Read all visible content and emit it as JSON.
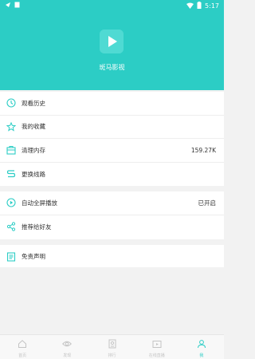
{
  "status_bar": {
    "time": "5:17"
  },
  "app": {
    "name": "斑马影视"
  },
  "menu_group_1": [
    {
      "label": "观看历史",
      "value": "",
      "icon": "history-clock-icon"
    },
    {
      "label": "我的收藏",
      "value": "",
      "icon": "favorite-star-icon"
    },
    {
      "label": "清理内存",
      "value": "159.27K",
      "icon": "clear-cache-icon"
    },
    {
      "label": "更换线路",
      "value": "",
      "icon": "switch-route-icon"
    }
  ],
  "menu_group_2": [
    {
      "label": "自动全屏播放",
      "value": "已开启",
      "icon": "play-circle-icon"
    },
    {
      "label": "推荐给好友",
      "value": "",
      "icon": "share-icon"
    }
  ],
  "menu_group_3": [
    {
      "label": "免责声明",
      "value": "",
      "icon": "disclaimer-book-icon"
    }
  ],
  "tabbar": [
    {
      "label": "首页",
      "icon": "home-icon",
      "active": false
    },
    {
      "label": "发现",
      "icon": "discover-eye-icon",
      "active": false
    },
    {
      "label": "排行",
      "icon": "rank-icon",
      "active": false
    },
    {
      "label": "在线直播",
      "icon": "live-tv-icon",
      "active": false
    },
    {
      "label": "我",
      "icon": "profile-icon",
      "active": true
    }
  ],
  "colors": {
    "accent": "#2ccdc5",
    "header_bg": "#2ccdc5",
    "background": "#f2f2f2"
  }
}
